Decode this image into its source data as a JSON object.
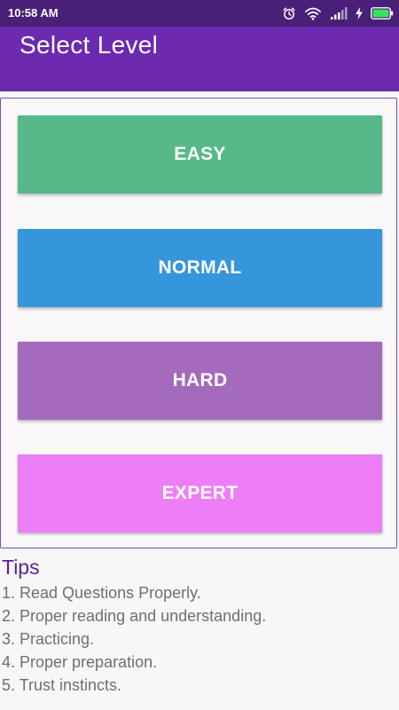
{
  "status_bar": {
    "time": "10:58 AM",
    "icons": [
      "alarm-clock-icon",
      "wifi-icon",
      "signal-icon",
      "charging-bolt-icon",
      "battery-icon"
    ]
  },
  "app_bar": {
    "title": "Select Level"
  },
  "levels": [
    {
      "label": "EASY",
      "color": "#57b889"
    },
    {
      "label": "NORMAL",
      "color": "#3596dc"
    },
    {
      "label": "HARD",
      "color": "#a46abb"
    },
    {
      "label": "EXPERT",
      "color": "#ed7ef8"
    }
  ],
  "tips": {
    "title": "Tips",
    "items": [
      "1. Read Questions Properly.",
      "2. Proper reading and understanding.",
      "3. Practicing.",
      "4. Proper preparation.",
      "5. Trust instincts."
    ]
  },
  "colors": {
    "status_bar": "#4a1f78",
    "app_bar": "#6b2ab0",
    "tips_title": "#5b1f9f",
    "panel_border": "#7b4bbd"
  }
}
